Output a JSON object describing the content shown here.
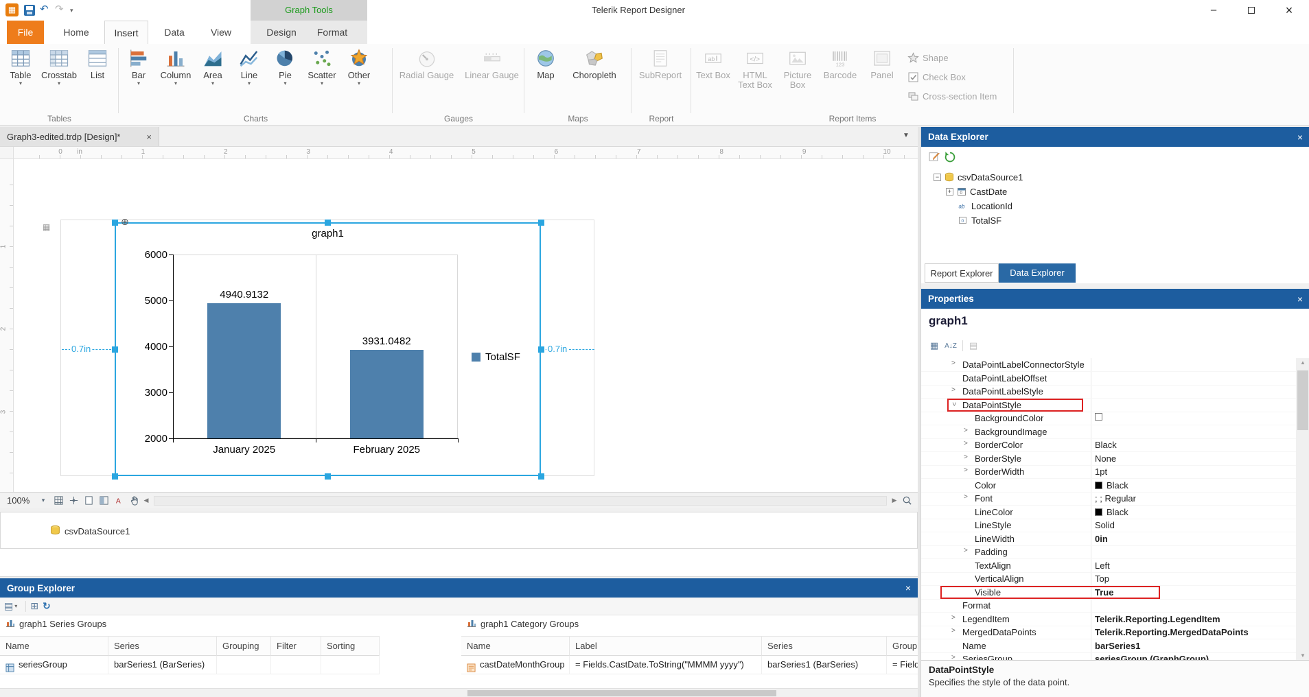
{
  "titlebar": {
    "app_title": "Telerik Report Designer",
    "contextual_group": "Graph Tools",
    "window_buttons": {
      "minimize": "–",
      "maximize": "",
      "close": "×"
    }
  },
  "ribbon": {
    "tabs": [
      {
        "label": "File",
        "type": "file"
      },
      {
        "label": "Home"
      },
      {
        "label": "Insert",
        "active": true
      },
      {
        "label": "Data"
      },
      {
        "label": "View"
      },
      {
        "label": "Design",
        "contextual": true
      },
      {
        "label": "Format",
        "contextual": true
      }
    ],
    "groups": [
      {
        "label": "Tables",
        "items": [
          {
            "label": "Table",
            "icon": "table",
            "dropdown": true
          },
          {
            "label": "Crosstab",
            "icon": "crosstab",
            "dropdown": true
          },
          {
            "label": "List",
            "icon": "list"
          }
        ]
      },
      {
        "label": "Charts",
        "items": [
          {
            "label": "Bar",
            "icon": "bar",
            "dropdown": true
          },
          {
            "label": "Column",
            "icon": "column",
            "dropdown": true
          },
          {
            "label": "Area",
            "icon": "area",
            "dropdown": true
          },
          {
            "label": "Line",
            "icon": "line",
            "dropdown": true
          },
          {
            "label": "Pie",
            "icon": "pie",
            "dropdown": true
          },
          {
            "label": "Scatter",
            "icon": "scatter",
            "dropdown": true
          },
          {
            "label": "Other",
            "icon": "other",
            "dropdown": true
          }
        ]
      },
      {
        "label": "Gauges",
        "items": [
          {
            "label": "Radial Gauge",
            "icon": "radial",
            "disabled": true
          },
          {
            "label": "Linear Gauge",
            "icon": "linear",
            "disabled": true
          }
        ]
      },
      {
        "label": "Maps",
        "items": [
          {
            "label": "Map",
            "icon": "map"
          },
          {
            "label": "Choropleth",
            "icon": "choropleth"
          }
        ]
      },
      {
        "label": "Report",
        "items": [
          {
            "label": "SubReport",
            "icon": "subreport",
            "disabled": true
          }
        ]
      },
      {
        "label": "Report Items",
        "items": [
          {
            "label": "Text Box",
            "icon": "textbox",
            "disabled": true
          },
          {
            "label": "HTML Text Box",
            "icon": "htmltextbox",
            "disabled": true
          },
          {
            "label": "Picture Box",
            "icon": "picturebox",
            "disabled": true
          },
          {
            "label": "Barcode",
            "icon": "barcode",
            "disabled": true
          },
          {
            "label": "Panel",
            "icon": "panel",
            "disabled": true
          }
        ],
        "side_items": [
          {
            "label": "Shape",
            "icon": "shape",
            "disabled": true
          },
          {
            "label": "Check Box",
            "icon": "checkbox",
            "disabled": true
          },
          {
            "label": "Cross-section Item",
            "icon": "crosssection",
            "disabled": true
          }
        ]
      }
    ]
  },
  "document_tab": {
    "title": "Graph3-edited.trdp [Design]*",
    "close": "×"
  },
  "designer": {
    "ruler_unit": "in",
    "ruler_numbers": [
      "0",
      "1",
      "2",
      "3",
      "4",
      "5",
      "6",
      "7",
      "8",
      "9",
      "10"
    ],
    "v_ruler_numbers": [
      "1",
      "2",
      "3"
    ],
    "dimension_left": "0.7in",
    "dimension_right": "0.7in",
    "zoom": "100%",
    "datasource_item": "csvDataSource1"
  },
  "chart_data": {
    "type": "bar",
    "title": "graph1",
    "categories": [
      "January 2025",
      "February 2025"
    ],
    "series": [
      {
        "name": "TotalSF",
        "values": [
          4940.9132,
          3931.0482
        ]
      }
    ],
    "value_labels": [
      "4940.9132",
      "3931.0482"
    ],
    "y_ticks": [
      2000,
      3000,
      4000,
      5000,
      6000
    ],
    "ylim": [
      2000,
      6000
    ],
    "legend": {
      "position": "right",
      "entries": [
        "TotalSF"
      ]
    },
    "bar_color": "#4e80ac",
    "grid": false
  },
  "group_explorer": {
    "title": "Group Explorer",
    "close": "×",
    "series_table": {
      "caption": "graph1 Series Groups",
      "columns": [
        "Name",
        "Series",
        "Grouping",
        "Filter",
        "Sorting"
      ],
      "rows": [
        [
          "seriesGroup",
          "barSeries1 (BarSeries)",
          "",
          "",
          ""
        ]
      ]
    },
    "category_table": {
      "caption": "graph1 Category Groups",
      "columns": [
        "Name",
        "Label",
        "Series",
        "Grouping"
      ],
      "rows": [
        [
          "castDateMonthGroup",
          "= Fields.CastDate.ToString(\"MMMM yyyy\")",
          "barSeries1 (BarSeries)",
          "= Fields.CastDate"
        ]
      ]
    }
  },
  "data_explorer": {
    "title": "Data Explorer",
    "close": "×",
    "tree": {
      "root": {
        "label": "csvDataSource1",
        "expander": "-",
        "icon": "datasource"
      },
      "children": [
        {
          "label": "CastDate",
          "expander": "+",
          "icon": "date"
        },
        {
          "label": "LocationId",
          "icon": "text"
        },
        {
          "label": "TotalSF",
          "icon": "number"
        }
      ]
    },
    "tabs": [
      {
        "label": "Report Explorer"
      },
      {
        "label": "Data Explorer",
        "active": true
      }
    ]
  },
  "properties": {
    "title": "Properties",
    "close": "×",
    "object_name": "graph1",
    "rows": [
      {
        "name": "DataPointLabelConnectorStyle",
        "value": "",
        "level": 1,
        "exp": "closed"
      },
      {
        "name": "DataPointLabelOffset",
        "value": "",
        "level": 1
      },
      {
        "name": "DataPointLabelStyle",
        "value": "",
        "level": 1,
        "exp": "closed"
      },
      {
        "name": "DataPointStyle",
        "value": "",
        "level": 1,
        "exp": "open",
        "highlight": "name"
      },
      {
        "name": "BackgroundColor",
        "value": "",
        "level": 2,
        "swatch": "#ffffff"
      },
      {
        "name": "BackgroundImage",
        "value": "",
        "level": 2,
        "exp": "closed"
      },
      {
        "name": "BorderColor",
        "value": "Black",
        "level": 2,
        "exp": "closed"
      },
      {
        "name": "BorderStyle",
        "value": "None",
        "level": 2,
        "exp": "closed"
      },
      {
        "name": "BorderWidth",
        "value": "1pt",
        "level": 2,
        "exp": "closed"
      },
      {
        "name": "Color",
        "value": "Black",
        "level": 2,
        "swatch": "#000000"
      },
      {
        "name": "Font",
        "value": "; ; Regular",
        "level": 2,
        "exp": "closed"
      },
      {
        "name": "LineColor",
        "value": "Black",
        "level": 2,
        "swatch": "#000000"
      },
      {
        "name": "LineStyle",
        "value": "Solid",
        "level": 2
      },
      {
        "name": "LineWidth",
        "value": "0in",
        "level": 2,
        "bold": true
      },
      {
        "name": "Padding",
        "value": "",
        "level": 2,
        "exp": "closed"
      },
      {
        "name": "TextAlign",
        "value": "Left",
        "level": 2
      },
      {
        "name": "VerticalAlign",
        "value": "Top",
        "level": 2
      },
      {
        "name": "Visible",
        "value": "True",
        "level": 2,
        "bold": true,
        "highlight": "row"
      },
      {
        "name": "Format",
        "value": "",
        "level": 1
      },
      {
        "name": "LegendItem",
        "value": "Telerik.Reporting.LegendItem",
        "level": 1,
        "exp": "closed",
        "bold": true
      },
      {
        "name": "MergedDataPoints",
        "value": "Telerik.Reporting.MergedDataPoints",
        "level": 1,
        "exp": "closed",
        "bold": true
      },
      {
        "name": "Name",
        "value": "barSeries1",
        "level": 1,
        "bold": true
      },
      {
        "name": "SeriesGroup",
        "value": "seriesGroup (GraphGroup)",
        "level": 1,
        "exp": "closed",
        "bold": true
      }
    ],
    "description": {
      "name": "DataPointStyle",
      "text": "Specifies the style of the data point."
    }
  }
}
